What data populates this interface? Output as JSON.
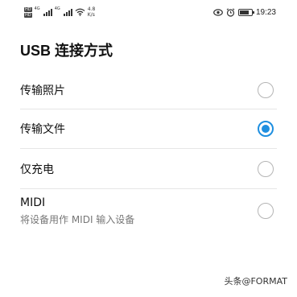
{
  "status_bar": {
    "network_badge_top": "HD",
    "network_badge_bottom": "HD",
    "signal1_type": "4G",
    "signal2_type": "4G",
    "speed_value": "4.8",
    "speed_unit": "K/s",
    "time": "19:23",
    "icons": [
      "eye-icon",
      "alarm-icon",
      "battery-icon"
    ]
  },
  "dialog": {
    "title": "USB 连接方式",
    "options": [
      {
        "label": "传输照片",
        "sublabel": "",
        "selected": false
      },
      {
        "label": "传输文件",
        "sublabel": "",
        "selected": true
      },
      {
        "label": "仅充电",
        "sublabel": "",
        "selected": false
      },
      {
        "label": "MIDI",
        "sublabel": "将设备用作 MIDI 输入设备",
        "selected": false
      }
    ]
  },
  "accent_color": "#1e8fe0",
  "watermark": "头条@FORMAT"
}
